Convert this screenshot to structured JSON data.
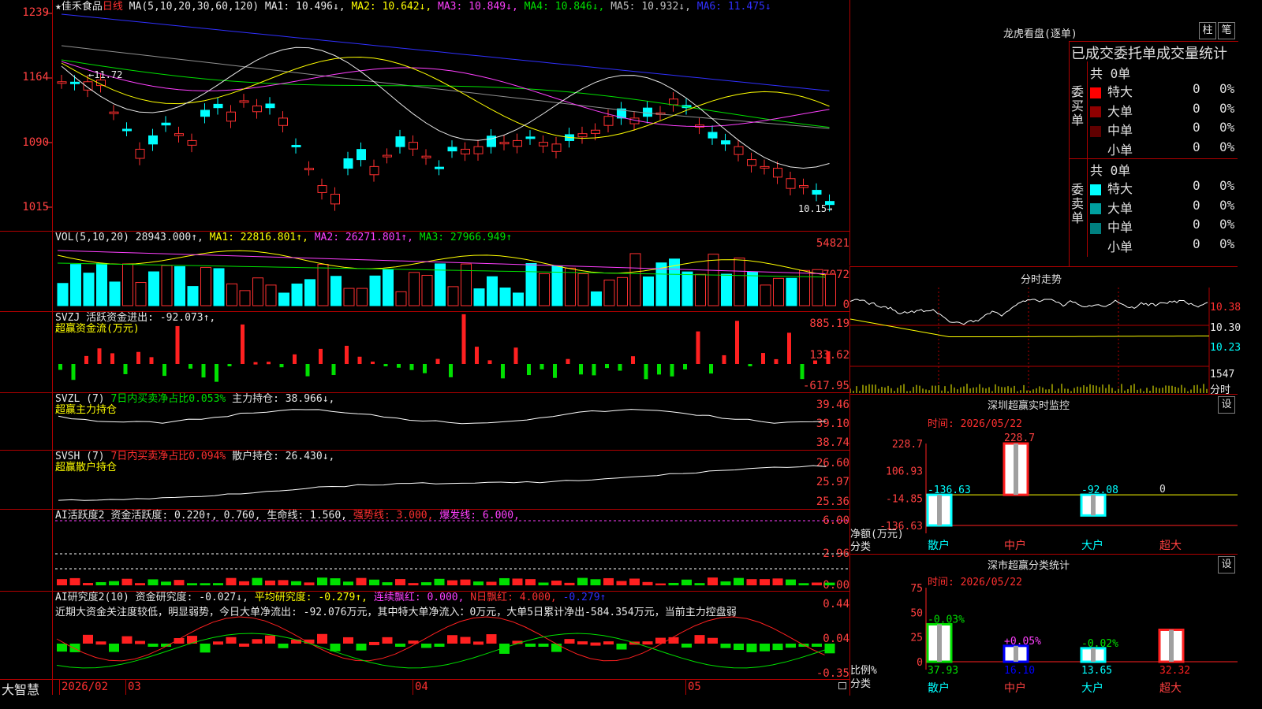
{
  "header": {
    "stock": "★佳禾食品",
    "period": "日线",
    "ma_label": "MA(5,10,20,30,60,120)",
    "ma": [
      {
        "label": "MA1: 10.496↓,",
        "color": "#e8e8e8"
      },
      {
        "label": "MA2: 10.642↓,",
        "color": "#ffff00"
      },
      {
        "label": "MA3: 10.849↓,",
        "color": "#ff40ff"
      },
      {
        "label": "MA4: 10.846↓,",
        "color": "#00e000"
      },
      {
        "label": "MA5: 10.932↓,",
        "color": "#c0c0c0"
      },
      {
        "label": "MA6: 11.475↓",
        "color": "#3030ff"
      }
    ]
  },
  "price_axis": [
    "1239",
    "1164",
    "1090",
    "1015"
  ],
  "hi_mark": "11.72",
  "lo_mark": "10.15",
  "vol_header": {
    "label": "VOL(5,10,20)",
    "v": "28943.000↑,",
    "ma1": "MA1: 22816.801↑,",
    "ma2": "MA2: 26271.801↑,",
    "ma3": "MA3: 27966.949↑"
  },
  "vol_axis": [
    "54821",
    "27072",
    "0"
  ],
  "svzj": {
    "l1": "SVZJ  活跃资金进出: -92.073↑,",
    "l2": "超赢资金流(万元)",
    "axis": [
      "885.19",
      "133.62",
      "-617.95"
    ]
  },
  "svzl": {
    "name": "SVZL (7)",
    "a": "7日内买卖净占比0.053%",
    "b": "主力持仓: 38.966↓,",
    "l2": "超赢主力持仓",
    "axis": [
      "39.46",
      "39.10",
      "38.74"
    ]
  },
  "svsh": {
    "name": "SVSH (7)",
    "a": "7日内买卖净占比0.094%",
    "b": "散户持仓: 26.430↓,",
    "l2": "超赢散户持仓",
    "axis": [
      "26.60",
      "25.97",
      "25.36"
    ]
  },
  "ai1": {
    "name": "AI活跃度2",
    "a": "资金活跃度: 0.220↑, 0.760,",
    "b": "生命线: 1.560,",
    "c": "强势线: 3.000,",
    "d": "爆发线: 6.000,",
    "axis": [
      "6.00",
      "2.96",
      "0.00"
    ]
  },
  "ai2": {
    "name": "AI研究度2(10)",
    "a": "资金研究度: -0.027↓,",
    "b": "平均研究度: -0.279↑,",
    "c": "连续飘红: 0.000,",
    "d": "N日飘红: 4.000,",
    "e": "-0.279↑",
    "note": "近期大资金关注度较低，明显弱势，今日大单净流出: -92.076万元，其中特大单净流入：0万元，大单5日累计净出-584.354万元，当前主力控盘弱",
    "axis": [
      "0.44",
      "0.04",
      "-0.35"
    ]
  },
  "bottom": {
    "brand": "大智慧",
    "dates": [
      "2026/02",
      "03",
      "04",
      "05"
    ]
  },
  "lhb": {
    "title": "龙虎看盘(逐单)",
    "btn1": "柱",
    "btn2": "笔",
    "subtitle": "已成交委托单成交量统计",
    "buy_label": "委买单",
    "buy_total": "共 0单",
    "sell_label": "委卖单",
    "sell_total": "共 0单",
    "buy_rows": [
      {
        "name": "特大",
        "v": "0",
        "p": "0%",
        "color": "#ff0000"
      },
      {
        "name": "大单",
        "v": "0",
        "p": "0%",
        "color": "#900000"
      },
      {
        "name": "中单",
        "v": "0",
        "p": "0%",
        "color": "#600000"
      },
      {
        "name": "小单",
        "v": "0",
        "p": "0%",
        "color": "#000000"
      }
    ],
    "sell_rows": [
      {
        "name": "特大",
        "v": "0",
        "p": "0%",
        "color": "#00ffff"
      },
      {
        "name": "大单",
        "v": "0",
        "p": "0%",
        "color": "#00a0a0"
      },
      {
        "name": "中单",
        "v": "0",
        "p": "0%",
        "color": "#008080"
      },
      {
        "name": "小单",
        "v": "0",
        "p": "0%",
        "color": "#000000"
      }
    ]
  },
  "fenshi": {
    "title": "分时走势",
    "p1": "10.38",
    "p2": "10.30",
    "p3": "10.23",
    "vol": "1547",
    "vol_unit": "分时"
  },
  "monitor": {
    "title": "深圳超赢实时监控",
    "btn": "设",
    "time": "时间: 2026/05/22",
    "axis": [
      "228.7",
      "106.93",
      "-14.85",
      "-136.63"
    ],
    "ylabel": "净额(万元)",
    "xlabel": "分类"
  },
  "stats": {
    "title": "深市超赢分类统计",
    "btn": "设",
    "time": "时间: 2026/05/22",
    "axis": [
      "75",
      "50",
      "25",
      "0"
    ],
    "ylabel": "比例%",
    "xlabel": "分类"
  },
  "chart_data": [
    {
      "type": "bar",
      "title": "深圳超赢实时监控",
      "ylabel": "净额(万元)",
      "categories": [
        "散户",
        "中户",
        "大户",
        "超大"
      ],
      "values": [
        -136.63,
        228.7,
        -92.08,
        0
      ],
      "value_labels": [
        "-136.63",
        "228.7",
        "-92.08",
        "0"
      ],
      "ylim": [
        -136.63,
        228.7
      ]
    },
    {
      "type": "bar",
      "title": "深市超赢分类统计",
      "ylabel": "比例%",
      "categories": [
        "散户",
        "中户",
        "大户",
        "超大"
      ],
      "values": [
        37.93,
        16.1,
        13.65,
        32.32
      ],
      "value_labels": [
        "37.93",
        "16.10",
        "13.65",
        "32.32"
      ],
      "change_labels": [
        "-0.03%",
        "+0.05%",
        "-0.02%",
        ""
      ],
      "ylim": [
        0,
        75
      ]
    }
  ]
}
